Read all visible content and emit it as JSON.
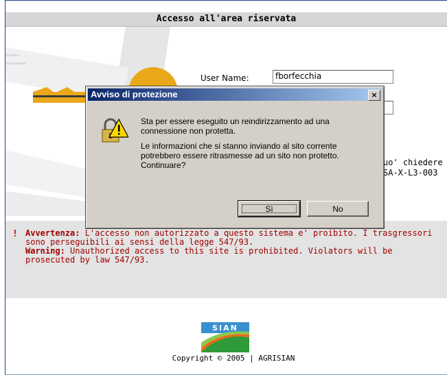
{
  "page": {
    "header_title": "Accesso all'area riservata",
    "username_label": "User Name:",
    "username_value": "fborfecchia",
    "password_value": "",
    "side_text_line1": "uo' chiedere",
    "side_text_line2": "SA-X-L3-003"
  },
  "warning": {
    "icon": "!",
    "it_label": "Avvertenza:",
    "it_text": " L'accesso non autorizzato a questo sistema e' proibito. I trasgressori sono perseguibili ai sensi della legge 547/93.",
    "en_label": "Warning:",
    "en_text": " Unauthorized access to this site is prohibited. Violators will be prosecuted by law 547/93."
  },
  "footer": {
    "logo_text": "SIAN",
    "copyright": "Copyright © 2005 | AGRISIAN"
  },
  "dialog": {
    "title": "Avviso di protezione",
    "close_label": "×",
    "message_1": "Sta per essere eseguito un reindirizzamento ad una connessione non protetta.",
    "message_2": "Le informazioni che si stanno inviando al sito corrente potrebbero essere ritrasmesse ad un sito non protetto. Continuare?",
    "yes_label": "Sì",
    "no_label": "No",
    "icon": "lock-warning-icon"
  },
  "colors": {
    "title_bar_start": "#0a246a",
    "title_bar_end": "#a6caf0",
    "warning_text": "#a00000",
    "dialog_bg": "#d4d0c8"
  }
}
